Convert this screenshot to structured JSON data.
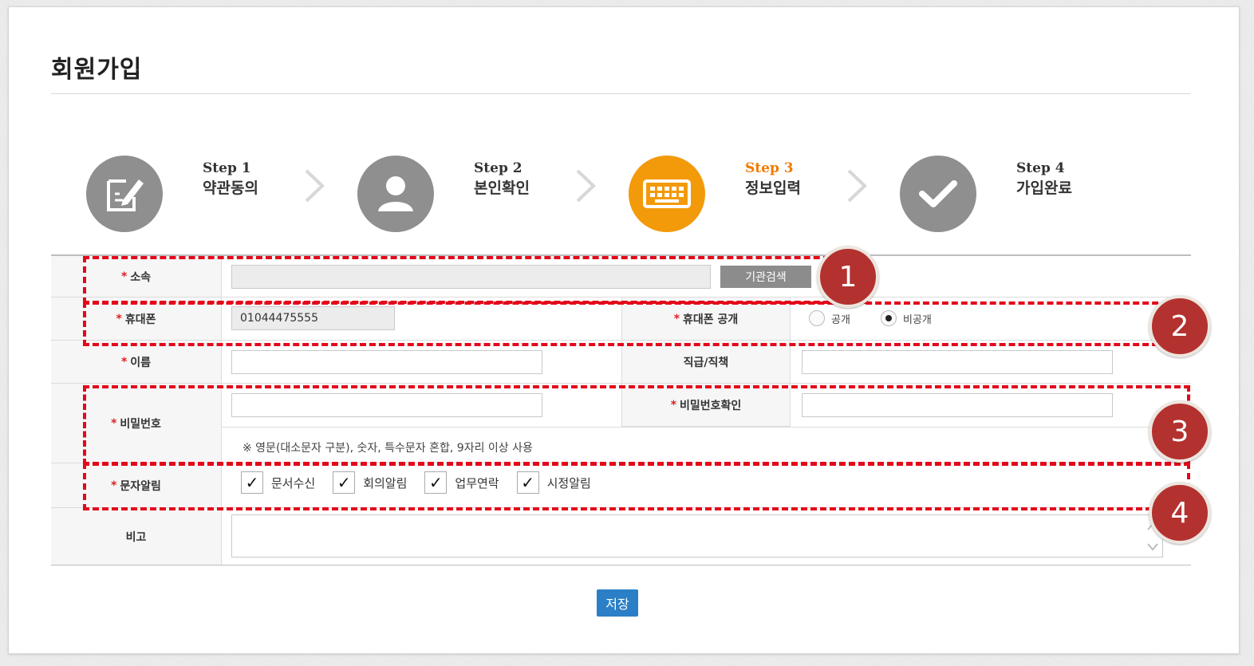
{
  "page_title": "회원가입",
  "steps": [
    {
      "no": "Step 1",
      "label": "약관동의",
      "icon": "edit-document-icon",
      "active": false
    },
    {
      "no": "Step 2",
      "label": "본인확인",
      "icon": "person-icon",
      "active": false
    },
    {
      "no": "Step 3",
      "label": "정보입력",
      "icon": "keyboard-icon",
      "active": true
    },
    {
      "no": "Step 4",
      "label": "가입완료",
      "icon": "checkmark-icon",
      "active": false
    }
  ],
  "form": {
    "affiliation": {
      "label": "소속",
      "value": "",
      "search_button": "기관검색"
    },
    "phone": {
      "label": "휴대폰",
      "value": "01044475555"
    },
    "phone_public": {
      "label": "휴대폰 공개",
      "options": [
        "공개",
        "비공개"
      ],
      "selected": "비공개"
    },
    "name": {
      "label": "이름",
      "value": ""
    },
    "position": {
      "label": "직급/직책",
      "value": ""
    },
    "password": {
      "label": "비밀번호",
      "value": ""
    },
    "password_confirm": {
      "label": "비밀번호확인",
      "value": ""
    },
    "password_note": "※ 영문(대소문자 구분), 숫자, 특수문자 혼합, 9자리 이상 사용",
    "sms": {
      "label": "문자알림",
      "options": [
        "문서수신",
        "회의알림",
        "업무연락",
        "시정알림"
      ],
      "checked": [
        true,
        true,
        true,
        true
      ]
    },
    "remarks": {
      "label": "비고",
      "value": ""
    },
    "required_mark": "*",
    "check_mark": "✓"
  },
  "save_button": "저장",
  "callouts": [
    "1",
    "2",
    "3",
    "4"
  ],
  "colors": {
    "accent": "#f39a0b",
    "step_inactive": "#8f8f8f",
    "callout": "#b3322f",
    "dashed": "#e3081a",
    "save": "#2a7fc6"
  }
}
